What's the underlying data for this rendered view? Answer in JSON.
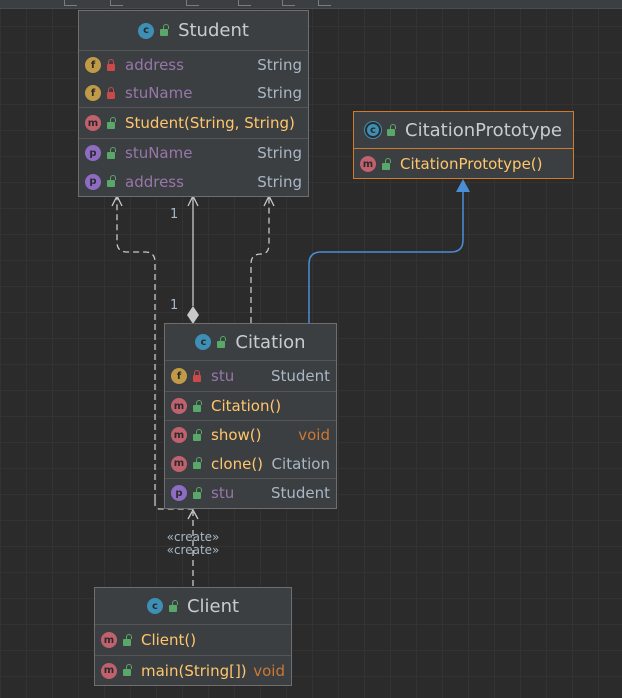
{
  "nodes": {
    "student": {
      "title": "Student",
      "fields": [
        {
          "name": "address",
          "type": "String"
        },
        {
          "name": "stuName",
          "type": "String"
        }
      ],
      "constructor": {
        "name": "Student(String, String)"
      },
      "properties": [
        {
          "name": "stuName",
          "type": "String"
        },
        {
          "name": "address",
          "type": "String"
        }
      ]
    },
    "citation_prototype": {
      "title": "CitationPrototype",
      "constructor": {
        "name": "CitationPrototype()"
      }
    },
    "citation": {
      "title": "Citation",
      "fields": [
        {
          "name": "stu",
          "type": "Student"
        }
      ],
      "constructor": {
        "name": "Citation()"
      },
      "methods": [
        {
          "name": "show()",
          "type": "void"
        },
        {
          "name": "clone()",
          "type": "Citation"
        }
      ],
      "properties": [
        {
          "name": "stu",
          "type": "Student"
        }
      ]
    },
    "client": {
      "title": "Client",
      "constructor": {
        "name": "Client()"
      },
      "methods": [
        {
          "name": "main(String[])",
          "type": "void"
        }
      ]
    }
  },
  "edges": {
    "multiplicity_student_end": "1",
    "multiplicity_citation_end": "1",
    "create_label_1": "«create»",
    "create_label_2": "«create»"
  },
  "colors": {
    "background": "#2b2b2b",
    "node_border": "#6e6e6e",
    "selected_border": "#cf7a2c",
    "field_text": "#9876aa",
    "method_text": "#ffc66d",
    "void_text": "#cc7832",
    "inheritance_edge": "#4a8fd6"
  }
}
